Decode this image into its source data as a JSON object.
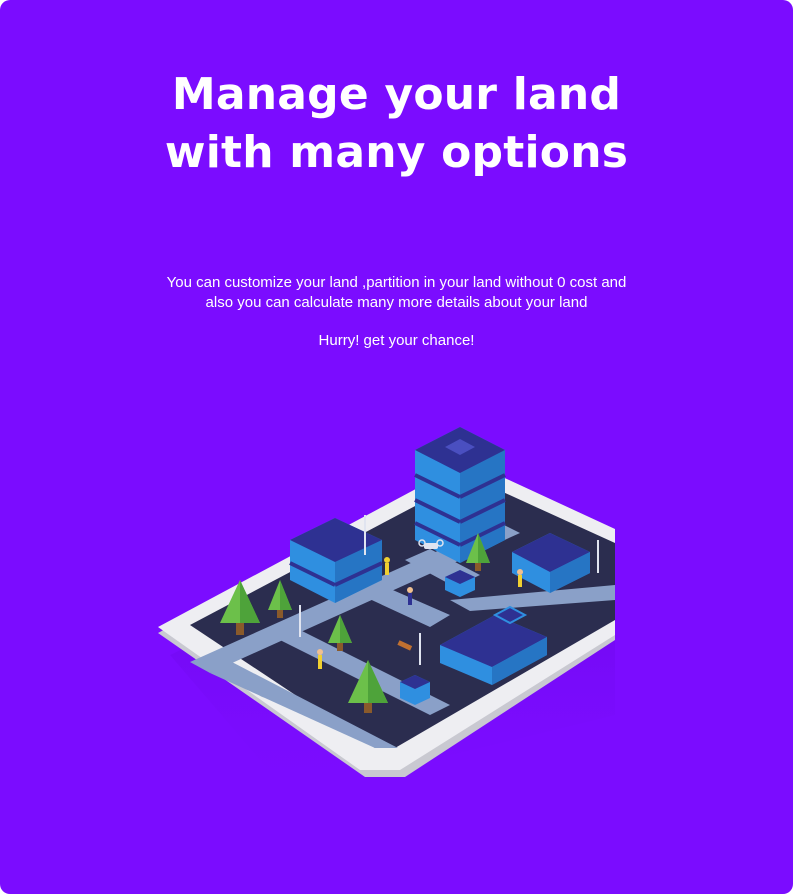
{
  "hero": {
    "headline_line1": "Manage your land",
    "headline_line2": "with many options",
    "description_line1": "You can customize your land ,partition in your land without 0 cost and",
    "description_line2": "also you can  calculate many more details  about your land",
    "cta_text": "Hurry! get your chance!"
  },
  "illustration": {
    "subject": "isometric tablet showing a city plot with buildings, trees, roads and surveyors",
    "icon": "tablet-city-illustration"
  },
  "colors": {
    "background": "#7b0cff",
    "text": "#ffffff",
    "building_top": "#2e3192",
    "building_side": "#2f8fe0",
    "tree": "#6cc04a",
    "ground": "#2b2d4f",
    "road": "#8aa0c8",
    "tablet_frame": "#e8e8ec"
  }
}
